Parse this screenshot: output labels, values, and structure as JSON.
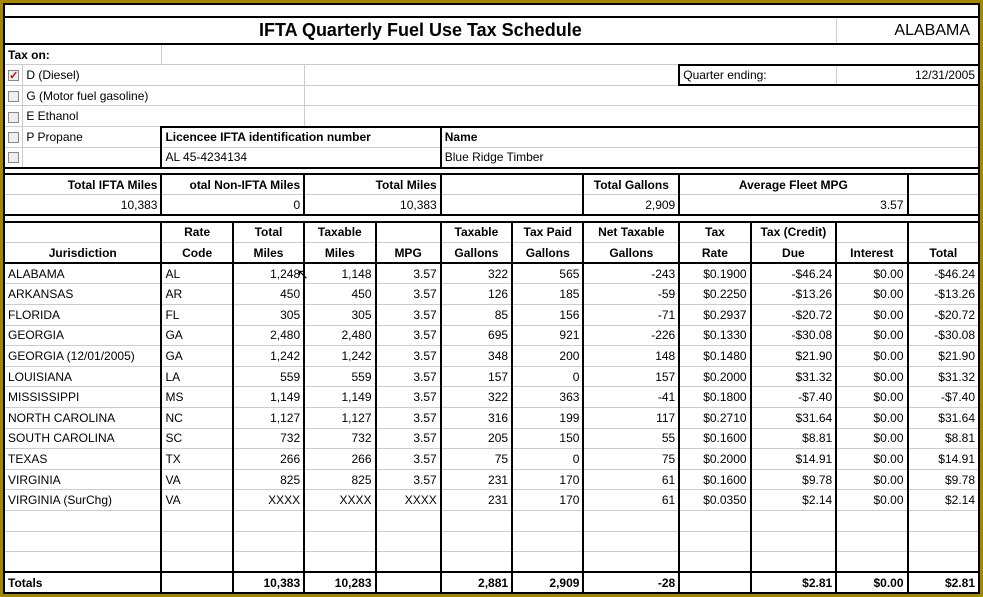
{
  "title": "IFTA Quarterly Fuel Use Tax Schedule",
  "state": "ALABAMA",
  "tax_on_label": "Tax on:",
  "fuels": [
    {
      "label": "D (Diesel)",
      "checked": true
    },
    {
      "label": "G (Motor fuel gasoline)",
      "checked": false
    },
    {
      "label": "E Ethanol",
      "checked": false
    },
    {
      "label": "P Propane",
      "checked": false
    }
  ],
  "quarter_ending_label": "Quarter ending:",
  "quarter_ending_value": "12/31/2005",
  "licensee_label": "Licencee IFTA identification number",
  "licensee_value": "AL 45-4234134",
  "name_label": "Name",
  "name_value": "Blue Ridge Timber",
  "summary": {
    "total_ifta_miles_label": "Total IFTA Miles",
    "total_ifta_miles_value": "10,383",
    "total_non_ifta_label": "otal Non-IFTA Miles",
    "total_non_ifta_value": "0",
    "total_miles_label": "Total Miles",
    "total_miles_value": "10,383",
    "total_gallons_label": "Total Gallons",
    "total_gallons_value": "2,909",
    "avg_mpg_label": "Average Fleet MPG",
    "avg_mpg_value": "3.57"
  },
  "headers": {
    "jurisdiction1": "",
    "jurisdiction2": "Jurisdiction",
    "rate1": "Rate",
    "rate2": "Code",
    "tmiles1": "Total",
    "tmiles2": "Miles",
    "txmiles1": "Taxable",
    "txmiles2": "Miles",
    "mpg1": "",
    "mpg2": "MPG",
    "txgal1": "Taxable",
    "txgal2": "Gallons",
    "tpgal1": "Tax Paid",
    "tpgal2": "Gallons",
    "netgal1": "Net Taxable",
    "netgal2": "Gallons",
    "txrate1": "Tax",
    "txrate2": "Rate",
    "due1": "Tax (Credit)",
    "due2": "Due",
    "int1": "",
    "int2": "Interest",
    "tot1": "",
    "tot2": "Total"
  },
  "rows": [
    {
      "j": "ALABAMA",
      "rc": "AL",
      "tm": "1,248",
      "txm": "1,148",
      "mpg": "3.57",
      "txg": "322",
      "tpg": "565",
      "ng": "-243",
      "tr": "$0.1900",
      "due": "-$46.24",
      "int": "$0.00",
      "tot": "-$46.24"
    },
    {
      "j": "ARKANSAS",
      "rc": "AR",
      "tm": "450",
      "txm": "450",
      "mpg": "3.57",
      "txg": "126",
      "tpg": "185",
      "ng": "-59",
      "tr": "$0.2250",
      "due": "-$13.26",
      "int": "$0.00",
      "tot": "-$13.26"
    },
    {
      "j": "FLORIDA",
      "rc": "FL",
      "tm": "305",
      "txm": "305",
      "mpg": "3.57",
      "txg": "85",
      "tpg": "156",
      "ng": "-71",
      "tr": "$0.2937",
      "due": "-$20.72",
      "int": "$0.00",
      "tot": "-$20.72"
    },
    {
      "j": "GEORGIA",
      "rc": "GA",
      "tm": "2,480",
      "txm": "2,480",
      "mpg": "3.57",
      "txg": "695",
      "tpg": "921",
      "ng": "-226",
      "tr": "$0.1330",
      "due": "-$30.08",
      "int": "$0.00",
      "tot": "-$30.08"
    },
    {
      "j": "GEORGIA (12/01/2005)",
      "rc": "GA",
      "tm": "1,242",
      "txm": "1,242",
      "mpg": "3.57",
      "txg": "348",
      "tpg": "200",
      "ng": "148",
      "tr": "$0.1480",
      "due": "$21.90",
      "int": "$0.00",
      "tot": "$21.90"
    },
    {
      "j": "LOUISIANA",
      "rc": "LA",
      "tm": "559",
      "txm": "559",
      "mpg": "3.57",
      "txg": "157",
      "tpg": "0",
      "ng": "157",
      "tr": "$0.2000",
      "due": "$31.32",
      "int": "$0.00",
      "tot": "$31.32"
    },
    {
      "j": "MISSISSIPPI",
      "rc": "MS",
      "tm": "1,149",
      "txm": "1,149",
      "mpg": "3.57",
      "txg": "322",
      "tpg": "363",
      "ng": "-41",
      "tr": "$0.1800",
      "due": "-$7.40",
      "int": "$0.00",
      "tot": "-$7.40"
    },
    {
      "j": "NORTH CAROLINA",
      "rc": "NC",
      "tm": "1,127",
      "txm": "1,127",
      "mpg": "3.57",
      "txg": "316",
      "tpg": "199",
      "ng": "117",
      "tr": "$0.2710",
      "due": "$31.64",
      "int": "$0.00",
      "tot": "$31.64"
    },
    {
      "j": "SOUTH CAROLINA",
      "rc": "SC",
      "tm": "732",
      "txm": "732",
      "mpg": "3.57",
      "txg": "205",
      "tpg": "150",
      "ng": "55",
      "tr": "$0.1600",
      "due": "$8.81",
      "int": "$0.00",
      "tot": "$8.81"
    },
    {
      "j": "TEXAS",
      "rc": "TX",
      "tm": "266",
      "txm": "266",
      "mpg": "3.57",
      "txg": "75",
      "tpg": "0",
      "ng": "75",
      "tr": "$0.2000",
      "due": "$14.91",
      "int": "$0.00",
      "tot": "$14.91"
    },
    {
      "j": "VIRGINIA",
      "rc": "VA",
      "tm": "825",
      "txm": "825",
      "mpg": "3.57",
      "txg": "231",
      "tpg": "170",
      "ng": "61",
      "tr": "$0.1600",
      "due": "$9.78",
      "int": "$0.00",
      "tot": "$9.78"
    },
    {
      "j": "VIRGINIA (SurChg)",
      "rc": "VA",
      "tm": "XXXX",
      "txm": "XXXX",
      "mpg": "XXXX",
      "txg": "231",
      "tpg": "170",
      "ng": "61",
      "tr": "$0.0350",
      "due": "$2.14",
      "int": "$0.00",
      "tot": "$2.14"
    }
  ],
  "totals": {
    "label": "Totals",
    "tm": "10,383",
    "txm": "10,283",
    "txg": "2,881",
    "tpg": "2,909",
    "ng": "-28",
    "due": "$2.81",
    "int": "$0.00",
    "tot": "$2.81"
  }
}
